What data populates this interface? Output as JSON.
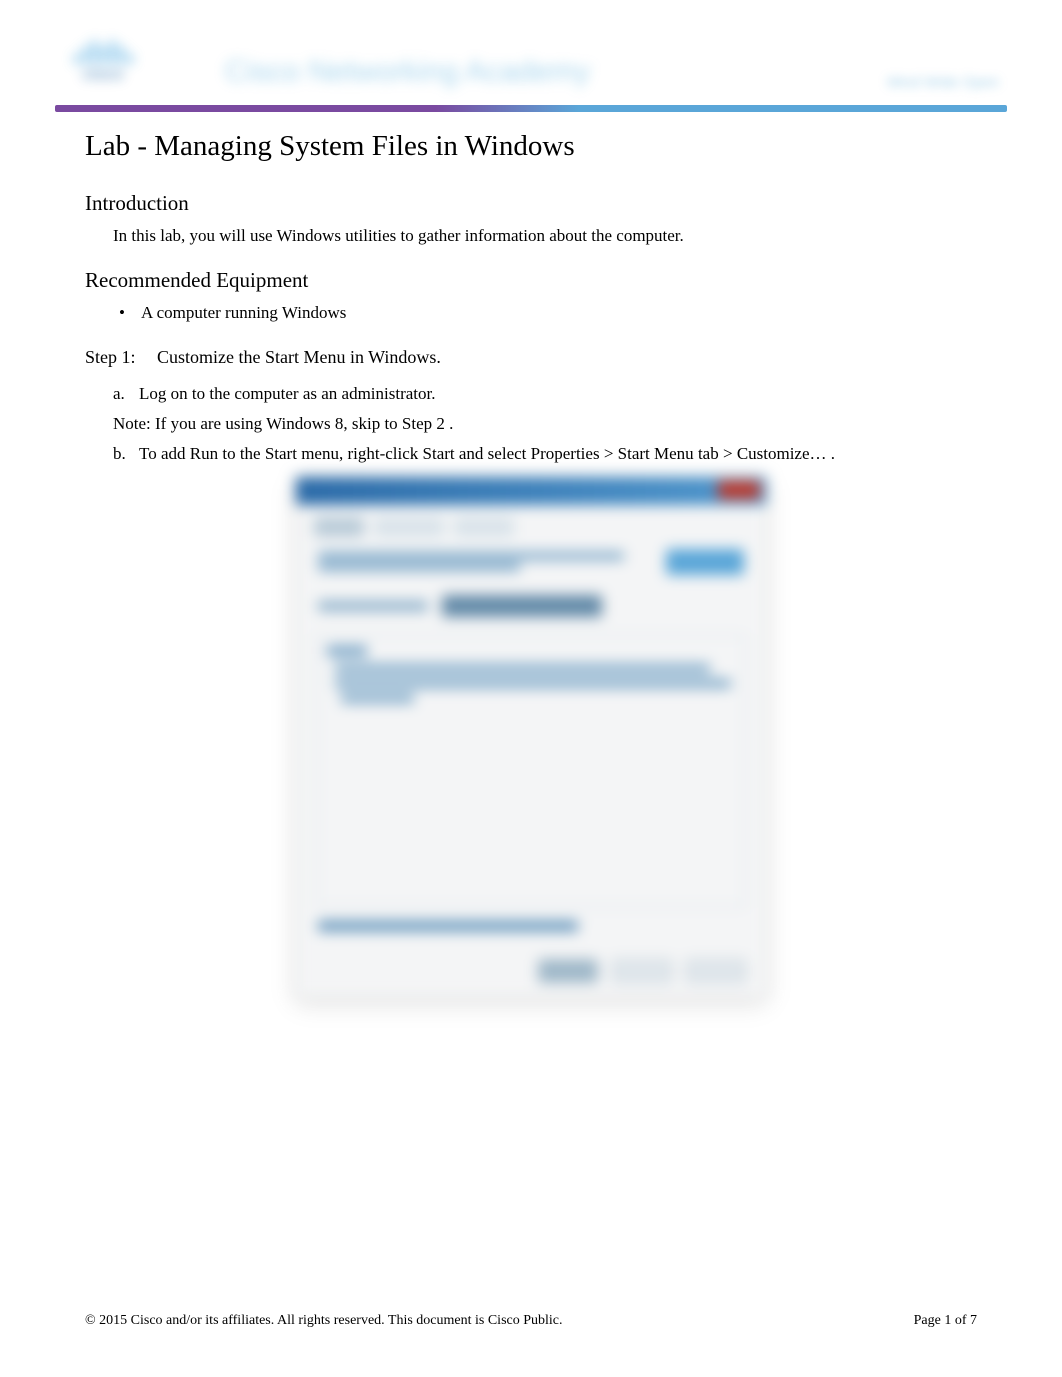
{
  "header": {
    "logo_text": "cisco",
    "academy": "Cisco Networking Academy",
    "tagline": "Mind Wide Open"
  },
  "title": "Lab - Managing System Files in Windows",
  "sections": {
    "intro_heading": "Introduction",
    "intro_text": "In this lab, you will use Windows utilities to gather information about the computer.",
    "equip_heading": "Recommended Equipment",
    "equip_item": "A computer running Windows"
  },
  "step1": {
    "label": "Step 1:",
    "title": "Customize the Start Menu in Windows.",
    "a_letter": "a.",
    "a_text": "Log on to the computer as an administrator.",
    "note_label": "Note",
    "note_text1": ": If you are using Windows 8, skip to ",
    "note_step2": "Step 2",
    "note_period": " .",
    "b_letter": "b.",
    "b_text1": "To  add ",
    "b_run": "Run",
    "b_text2": "  to the Start menu, right-click ",
    "b_start": "Start",
    "b_text3": "  and select ",
    "b_props": "Properties > Start Menu ",
    "b_tab": "tab",
    "b_text4": " > ",
    "b_customize": "Customize…",
    "b_end": " ."
  },
  "footer": {
    "copyright": "© 2015 Cisco and/or its affiliates. All rights reserved. This document is Cisco Public.",
    "page_label": "Page ",
    "page_current": "1",
    "page_of": " of ",
    "page_total": "7"
  }
}
